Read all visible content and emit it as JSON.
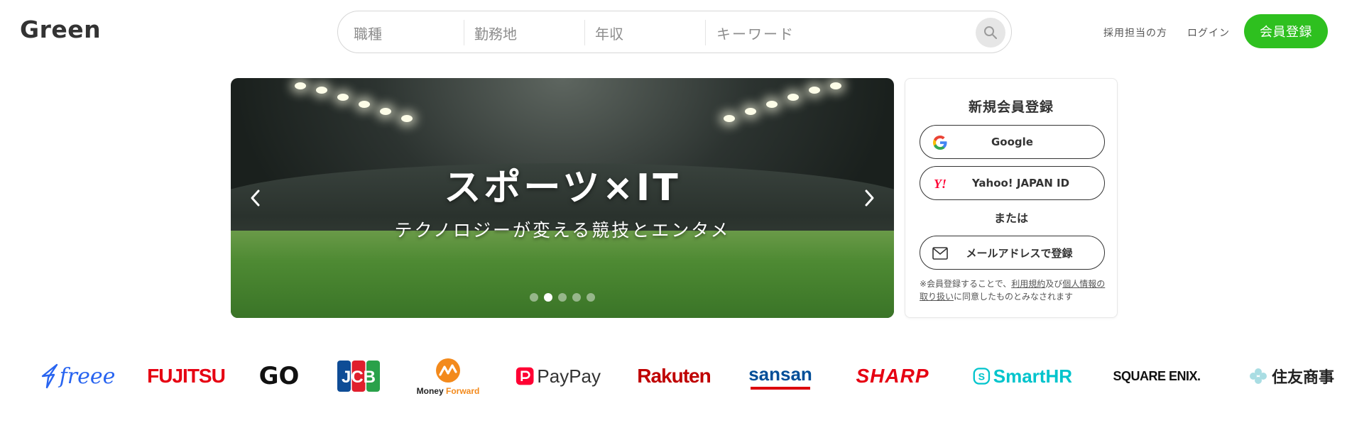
{
  "header": {
    "logo_text": "Green",
    "search": {
      "occupation_placeholder": "職種",
      "location_placeholder": "勤務地",
      "salary_placeholder": "年収",
      "keyword_placeholder": "キーワード"
    },
    "recruiter_link": "採用担当の方",
    "login_link": "ログイン",
    "register_button": "会員登録"
  },
  "banner": {
    "title": "スポーツ×IT",
    "subtitle": "テクノロジーが変える競技とエンタメ",
    "slide_count": 5,
    "active_slide": 2
  },
  "signup": {
    "title": "新規会員登録",
    "google_label": "Google",
    "yahoo_label": "Yahoo! JAPAN ID",
    "or_label": "または",
    "email_label": "メールアドレスで登録",
    "terms_prefix": "※会員登録することで、",
    "terms_link": "利用規約",
    "terms_and": "及び",
    "privacy_link": "個人情報の取り扱い",
    "terms_suffix": "に同意したものとみなされます"
  },
  "company_logos": {
    "freee": "freee",
    "fujitsu": "FUJITSU",
    "go": "GO",
    "jcb": "JCB",
    "moneyforward_money": "Money",
    "moneyforward_forward": "Forward",
    "paypay": "PayPay",
    "rakuten": "Rakuten",
    "sansan": "sansan",
    "sharp": "SHARP",
    "smarthr": "SmartHR",
    "squareenix": "SQUARE ENIX.",
    "sumitomo": "住友商事"
  },
  "colors": {
    "brand_green": "#2ec01f",
    "text_dark": "#333333"
  }
}
